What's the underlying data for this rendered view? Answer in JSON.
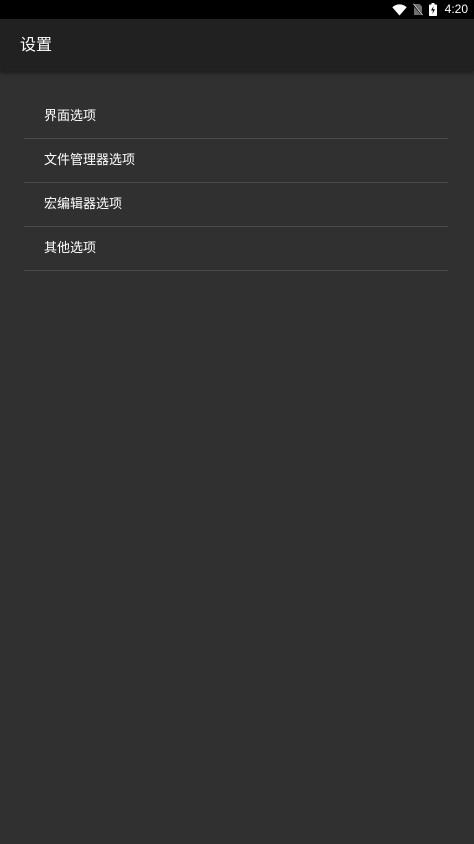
{
  "status_bar": {
    "time": "4:20",
    "icons": [
      "wifi-icon",
      "no-sim-icon",
      "battery-charging-icon"
    ]
  },
  "app_bar": {
    "title": "设置"
  },
  "settings_list": {
    "items": [
      {
        "label": "界面选项"
      },
      {
        "label": "文件管理器选项"
      },
      {
        "label": "宏编辑器选项"
      },
      {
        "label": "其他选项"
      }
    ]
  },
  "colors": {
    "status_bar": "#000000",
    "app_bar": "#212121",
    "background": "#303030",
    "divider": "#4a4a4a",
    "text": "#ffffff"
  }
}
